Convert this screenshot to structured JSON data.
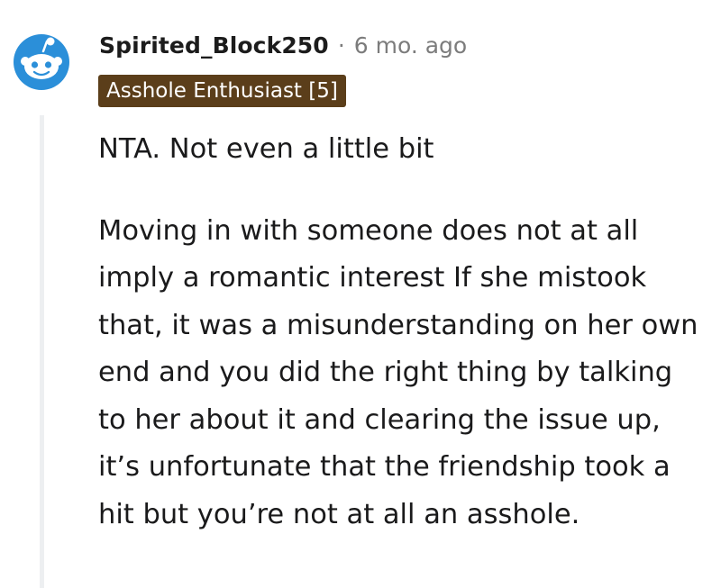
{
  "comment": {
    "author": "Spirited_Block250",
    "separator": "·",
    "timestamp": "6 mo. ago",
    "flair": "Asshole Enthusiast [5]",
    "paragraphs": [
      "NTA. Not even a little bit",
      "Moving in with someone does not at all imply a romantic interest If she mistook that, it was a misunderstanding on her own end and you did the right thing by talking to her about it and clearing the issue up, it’s unfortunate that the friendship took a hit but you’re not at all an asshole."
    ],
    "avatar_icon": "reddit-snoo-avatar-icon"
  },
  "colors": {
    "avatar_background": "#2b8fd9",
    "flair_background": "#5b3e1a",
    "muted_text": "#7c7c7c",
    "thread_line": "#edeff1"
  }
}
